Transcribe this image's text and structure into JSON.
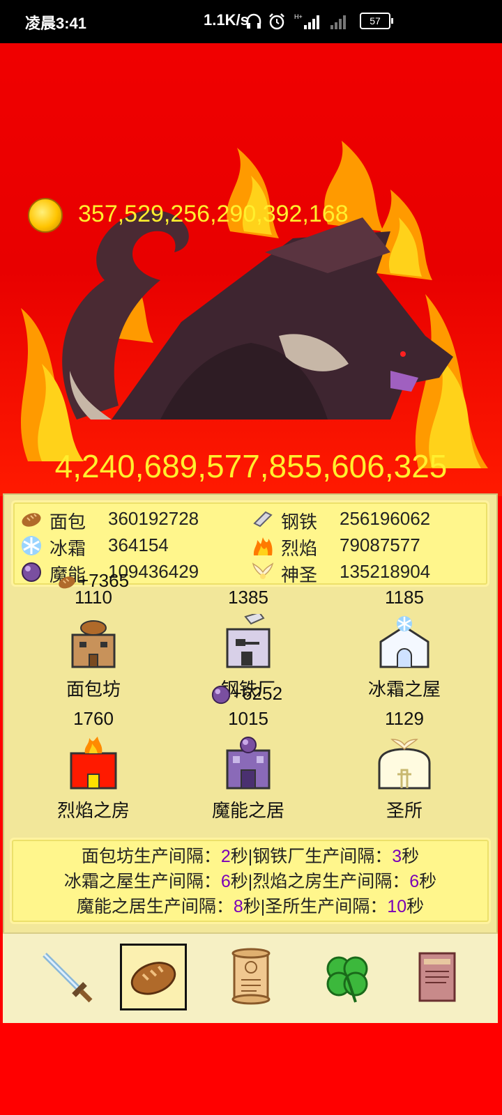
{
  "status_bar": {
    "time": "凌晨3:41",
    "network_speed": "1.1K/s",
    "battery": "57"
  },
  "gold": "357,529,256,290,392,168",
  "boss_hp": "4,240,689,577,855,606,325",
  "resources": [
    {
      "name": "面包",
      "value": "360192728",
      "icon": "bread-icon"
    },
    {
      "name": "钢铁",
      "value": "256196062",
      "icon": "steel-icon"
    },
    {
      "name": "冰霜",
      "value": "364154",
      "icon": "frost-icon"
    },
    {
      "name": "烈焰",
      "value": "79087577",
      "icon": "flame-icon"
    },
    {
      "name": "魔能",
      "value": "109436429",
      "icon": "magic-orb-icon"
    },
    {
      "name": "神圣",
      "value": "135218904",
      "icon": "holy-wings-icon"
    }
  ],
  "floating_gains": [
    {
      "text": "+7365",
      "icon": "bread-icon"
    },
    {
      "text": "+6252",
      "icon": "magic-orb-icon"
    }
  ],
  "buildings": [
    {
      "count": "1110",
      "name": "面包坊"
    },
    {
      "count": "1385",
      "name": "钢铁厂"
    },
    {
      "count": "1185",
      "name": "冰霜之屋"
    },
    {
      "count": "1760",
      "name": "烈焰之房"
    },
    {
      "count": "1015",
      "name": "魔能之居"
    },
    {
      "count": "1129",
      "name": "圣所"
    }
  ],
  "intervals": {
    "line1": {
      "a": "面包坊生产间隔：",
      "a_num": "2",
      "b": "秒|钢铁厂生产间隔：",
      "b_num": "3",
      "c": "秒"
    },
    "line2": {
      "a": "冰霜之屋生产间隔：",
      "a_num": "6",
      "b": "秒|烈焰之房生产间隔：",
      "b_num": "6",
      "c": "秒"
    },
    "line3": {
      "a": "魔能之居生产间隔：",
      "a_num": "8",
      "b": "秒|圣所生产间隔：",
      "b_num": "10",
      "c": "秒"
    }
  },
  "nav_tabs": [
    "sword-icon",
    "bread-icon",
    "scroll-icon",
    "clover-icon",
    "book-icon"
  ],
  "colors": {
    "background": "#ff0000",
    "panel": "#f2e79a",
    "highlight": "#fff68c",
    "number_accent": "#7a00b8",
    "gold_text": "#ffef2e"
  }
}
